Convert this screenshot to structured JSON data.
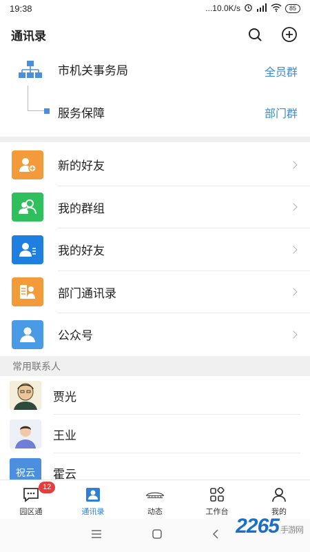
{
  "status_bar": {
    "time": "19:38",
    "network_speed": "...10.0K/s",
    "battery": "85"
  },
  "header": {
    "title": "通讯录"
  },
  "org": {
    "parent_name": "市机关事务局",
    "parent_tag": "全员群",
    "child_name": "服务保障",
    "child_tag": "部门群"
  },
  "menu": [
    {
      "label": "新的好友",
      "icon": "new-friend-icon",
      "color": "#f39a3a"
    },
    {
      "label": "我的群组",
      "icon": "group-icon",
      "color": "#2fbf5c"
    },
    {
      "label": "我的好友",
      "icon": "friend-icon",
      "color": "#1f7fe0"
    },
    {
      "label": "部门通讯录",
      "icon": "department-icon",
      "color": "#f39a3a"
    },
    {
      "label": "公众号",
      "icon": "official-account-icon",
      "color": "#4a9be6"
    }
  ],
  "frequent_contacts": {
    "header": "常用联系人",
    "items": [
      {
        "name": "贾光"
      },
      {
        "name": "王业"
      },
      {
        "name": "霍云",
        "avatar_text": "祝云"
      }
    ]
  },
  "tabbar": {
    "tabs": [
      {
        "label": "园区通",
        "badge": "12"
      },
      {
        "label": "通讯录"
      },
      {
        "label": "动态"
      },
      {
        "label": "工作台"
      },
      {
        "label": "我的"
      }
    ]
  },
  "watermark": {
    "text": "2265",
    "suffix": "手游网"
  },
  "colors": {
    "accent": "#2f7fd6",
    "tag": "#3d8bd4",
    "badge": "#e83b3b"
  }
}
